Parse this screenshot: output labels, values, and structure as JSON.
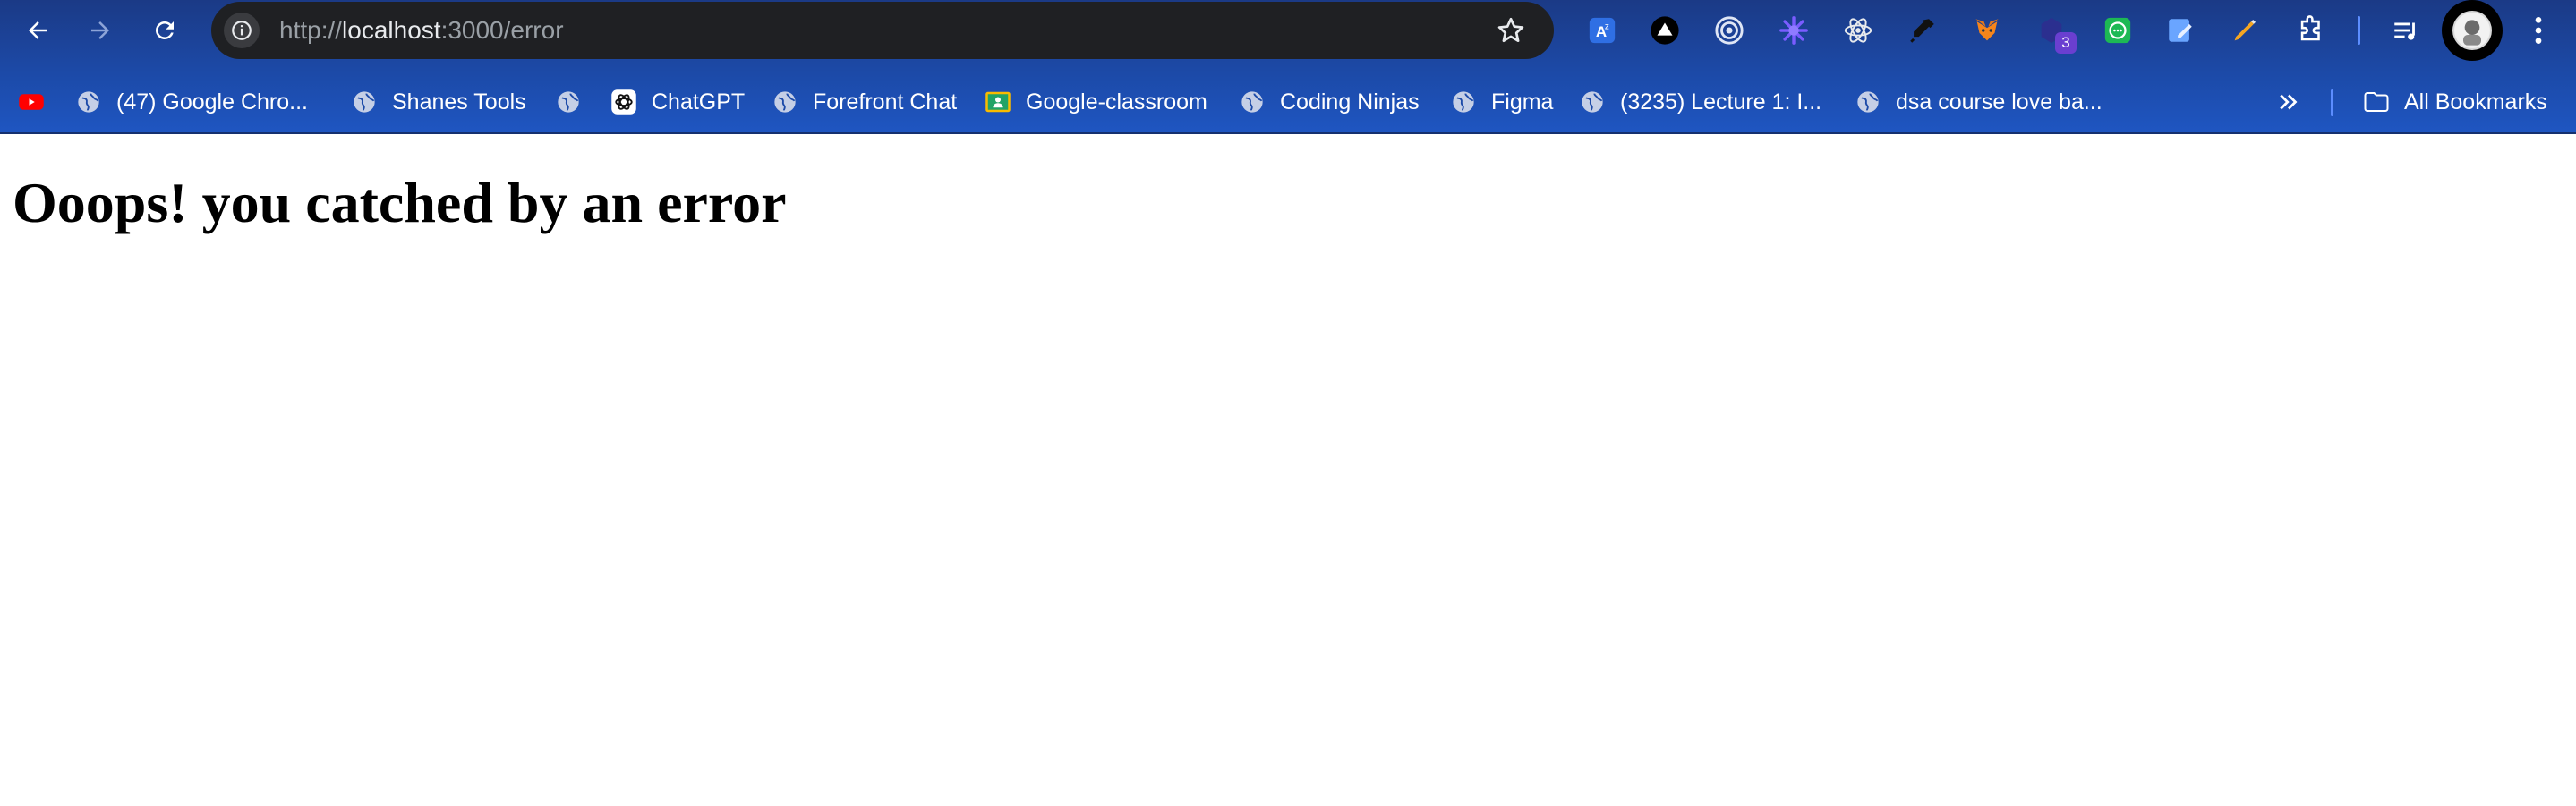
{
  "browser": {
    "url_scheme": "http://",
    "url_host": "localhost",
    "url_path": ":3000/error",
    "extension_badge": "3"
  },
  "bookmarks": {
    "items": [
      {
        "label": "",
        "icon": "youtube-icon"
      },
      {
        "label": "(47) Google Chro...",
        "icon": "globe-icon"
      },
      {
        "label": "Shanes Tools",
        "icon": "globe-icon"
      },
      {
        "label": "",
        "icon": "globe-icon"
      },
      {
        "label": "ChatGPT",
        "icon": "chatgpt-icon"
      },
      {
        "label": "Forefront Chat",
        "icon": "globe-icon"
      },
      {
        "label": "Google-classroom",
        "icon": "classroom-icon"
      },
      {
        "label": "Coding Ninjas",
        "icon": "globe-icon"
      },
      {
        "label": "Figma",
        "icon": "globe-icon"
      },
      {
        "label": "(3235) Lecture 1: I...",
        "icon": "globe-icon"
      },
      {
        "label": "dsa course love ba...",
        "icon": "globe-icon"
      }
    ],
    "all_bookmarks_label": "All Bookmarks"
  },
  "page": {
    "heading": "Ooops! you catched by an error"
  },
  "colors": {
    "chrome_top": "#1b3a86",
    "chrome_bottom": "#1f56c2",
    "omnibox": "#1f2023",
    "page_background": "#ffffff"
  }
}
